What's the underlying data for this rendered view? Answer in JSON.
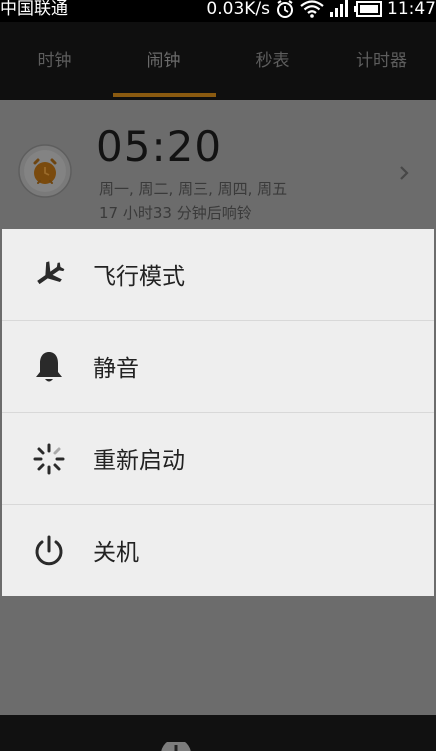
{
  "status_bar": {
    "carrier": "中国联通",
    "speed": "0.03K/s",
    "time": "11:47"
  },
  "tabs": [
    {
      "label": "时钟"
    },
    {
      "label": "闹钟"
    },
    {
      "label": "秒表"
    },
    {
      "label": "计时器"
    }
  ],
  "alarm": {
    "time": "05:20",
    "days": "周一, 周二, 周三, 周四, 周五",
    "remaining": "17 小时33 分钟后响铃"
  },
  "power_menu": {
    "items": [
      {
        "label": "飞行模式",
        "icon": "airplane-icon"
      },
      {
        "label": "静音",
        "icon": "bell-icon"
      },
      {
        "label": "重新启动",
        "icon": "restart-icon"
      },
      {
        "label": "关机",
        "icon": "power-icon"
      }
    ]
  },
  "colors": {
    "tab_indicator": "#8a5a10",
    "dialog_bg": "#eeeeee",
    "overlay_bg": "#6b6b6b"
  }
}
